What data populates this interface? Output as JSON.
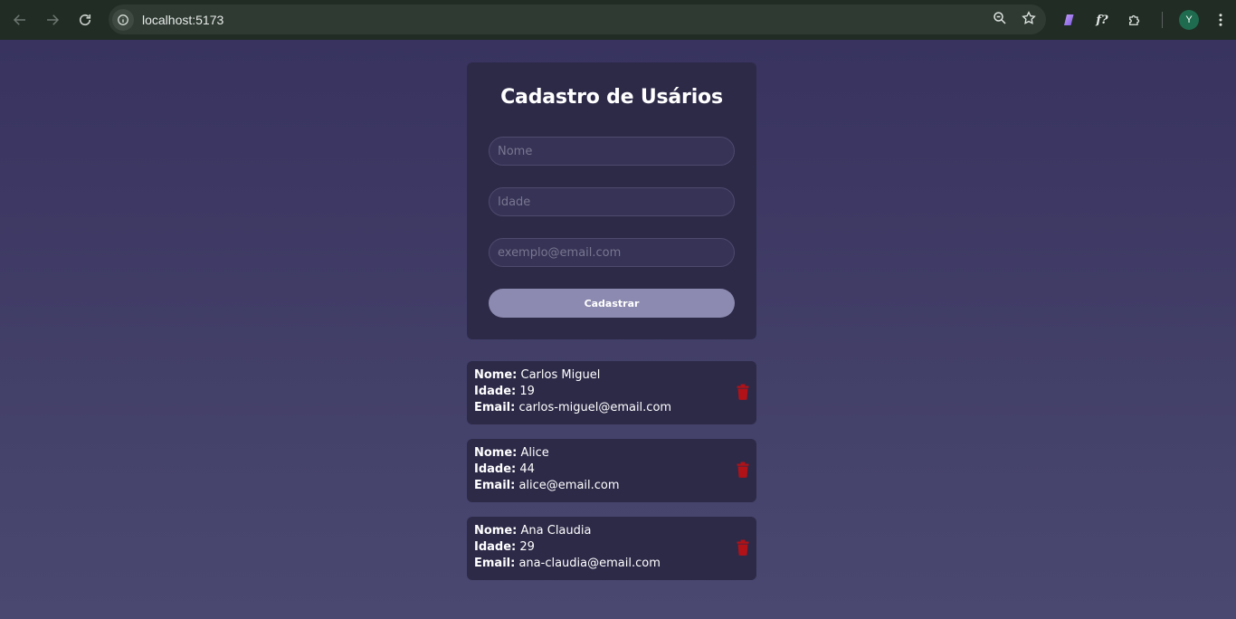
{
  "browser": {
    "url": "localhost:5173",
    "avatar_letter": "Y",
    "extension_fx_label": "f?"
  },
  "form": {
    "title": "Cadastro de Usários",
    "name_placeholder": "Nome",
    "age_placeholder": "Idade",
    "email_placeholder": "exemplo@email.com",
    "submit_label": "Cadastrar"
  },
  "labels": {
    "name": "Nome:",
    "age": "Idade:",
    "email": "Email:"
  },
  "users": [
    {
      "name": "Carlos Miguel",
      "age": "19",
      "email": "carlos-miguel@email.com"
    },
    {
      "name": "Alice",
      "age": "44",
      "email": "alice@email.com"
    },
    {
      "name": "Ana Claudia",
      "age": "29",
      "email": "ana-claudia@email.com"
    }
  ],
  "colors": {
    "page_background": "#3c375f",
    "card_background": "#2d2a48",
    "button_background": "#8c8ab0",
    "delete_icon": "#b01218"
  }
}
